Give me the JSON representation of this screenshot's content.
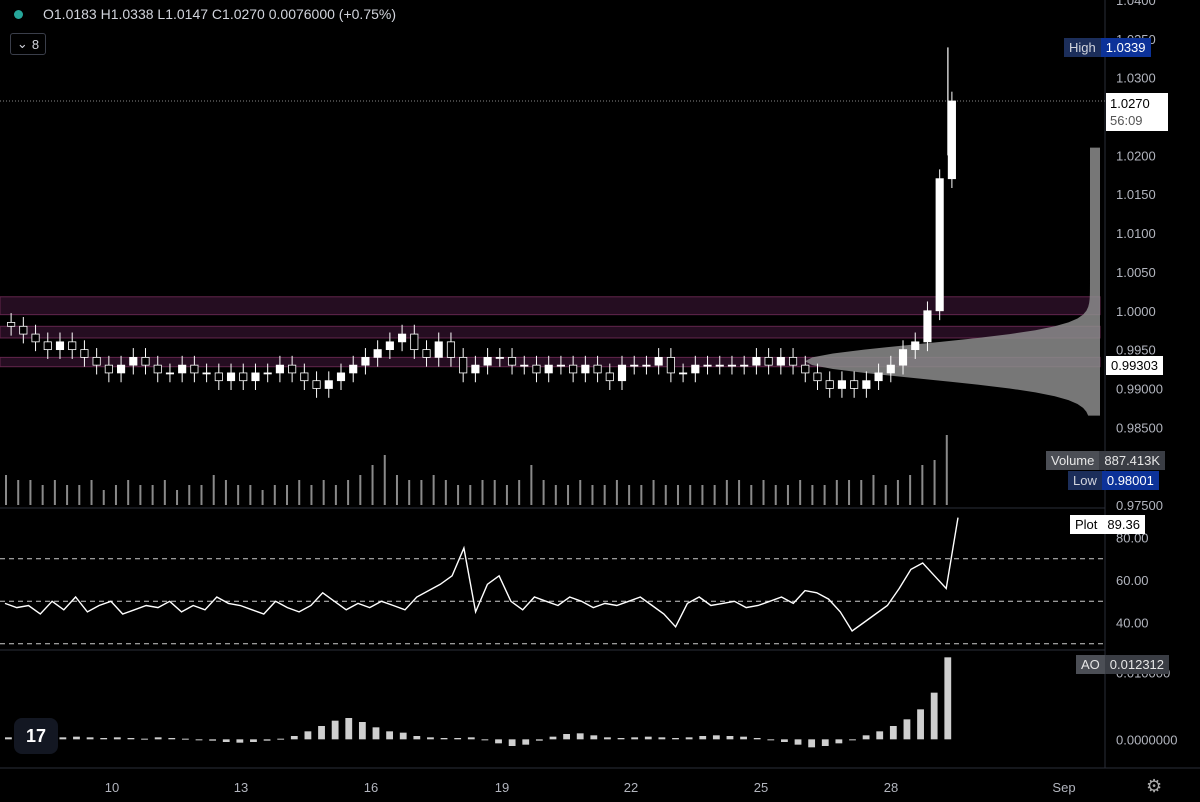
{
  "header": {
    "ohlc": "O1.0183 H1.0338 L1.0147 C1.0270 0.0076000 (+0.75%)",
    "indicator_count": "8"
  },
  "labels": {
    "high_key": "High",
    "high_value": "1.0339",
    "price_value": "1.0270",
    "countdown": "56:09",
    "poc_value": "0.99303",
    "volume_key": "Volume",
    "volume_value": "887.413K",
    "low_key": "Low",
    "low_value": "0.98001",
    "plot_key": "Plot",
    "plot_value": "89.36",
    "ao_key": "AO",
    "ao_value": "0.012312"
  },
  "colors": {
    "background": "#000000",
    "candle": "#ffffff",
    "grid_line": "#ffffff",
    "zone": "#3a1230",
    "profile": "#9a9a9a"
  },
  "chart_data": [
    {
      "type": "candlestick",
      "y_tick_labels": [
        "1.0400",
        "1.0350",
        "1.0300",
        "1.0200",
        "1.0150",
        "1.0100",
        "1.0050",
        "1.0000",
        "0.9950",
        "0.99000",
        "0.98500",
        "0.97500"
      ],
      "x_tick_labels": [
        "10",
        "13",
        "16",
        "19",
        "22",
        "25",
        "28",
        "Sep"
      ],
      "ylim": [
        0.975,
        1.04
      ],
      "last_close": 1.027,
      "high": 1.0339,
      "low": 0.98001,
      "close_series": [
        0.998,
        0.997,
        0.996,
        0.995,
        0.996,
        0.995,
        0.994,
        0.993,
        0.992,
        0.993,
        0.994,
        0.993,
        0.992,
        0.992,
        0.993,
        0.992,
        0.992,
        0.991,
        0.992,
        0.991,
        0.992,
        0.992,
        0.993,
        0.992,
        0.991,
        0.99,
        0.991,
        0.992,
        0.993,
        0.994,
        0.995,
        0.996,
        0.997,
        0.995,
        0.994,
        0.996,
        0.994,
        0.992,
        0.993,
        0.994,
        0.994,
        0.993,
        0.993,
        0.992,
        0.993,
        0.993,
        0.992,
        0.993,
        0.992,
        0.991,
        0.993,
        0.993,
        0.993,
        0.994,
        0.992,
        0.992,
        0.993,
        0.993,
        0.993,
        0.993,
        0.993,
        0.994,
        0.993,
        0.994,
        0.993,
        0.992,
        0.991,
        0.99,
        0.991,
        0.99,
        0.991,
        0.992,
        0.993,
        0.995,
        0.996,
        1.0,
        1.017,
        1.027
      ],
      "volume_series": [
        6,
        5,
        5,
        4,
        5,
        4,
        4,
        5,
        3,
        4,
        5,
        4,
        4,
        5,
        3,
        4,
        4,
        6,
        5,
        4,
        4,
        3,
        4,
        4,
        5,
        4,
        5,
        4,
        5,
        6,
        8,
        10,
        6,
        5,
        5,
        6,
        5,
        4,
        4,
        5,
        5,
        4,
        5,
        8,
        5,
        4,
        4,
        5,
        4,
        4,
        5,
        4,
        4,
        5,
        4,
        4,
        4,
        4,
        4,
        5,
        5,
        4,
        5,
        4,
        4,
        5,
        4,
        4,
        5,
        5,
        5,
        6,
        4,
        5,
        6,
        8,
        9,
        14
      ],
      "volume_label": "887.413K"
    },
    {
      "type": "line",
      "name": "Plot",
      "y_tick_labels": [
        "80.00",
        "60.00",
        "40.00"
      ],
      "ylim": [
        28,
        92
      ],
      "levels": [
        70,
        50,
        30
      ],
      "values": [
        49,
        47,
        48,
        44,
        50,
        46,
        52,
        45,
        48,
        50,
        44,
        46,
        48,
        47,
        50,
        45,
        48,
        46,
        52,
        49,
        48,
        46,
        44,
        50,
        47,
        45,
        48,
        54,
        50,
        46,
        49,
        47,
        50,
        48,
        46,
        52,
        55,
        58,
        62,
        75,
        45,
        58,
        62,
        50,
        46,
        52,
        50,
        48,
        52,
        50,
        47,
        49,
        48,
        50,
        52,
        48,
        44,
        38,
        49,
        52,
        48,
        49,
        50,
        47,
        48,
        50,
        52,
        49,
        55,
        54,
        51,
        45,
        36,
        40,
        44,
        48,
        56,
        65,
        68,
        62,
        56,
        89.36
      ],
      "value_label": "89.36"
    },
    {
      "type": "bar",
      "name": "AO",
      "y_tick_labels": [
        "0.010000",
        "0.0000000"
      ],
      "ylim": [
        -0.004,
        0.0125
      ],
      "values": [
        0.0003,
        0.0004,
        0.0003,
        0.0002,
        0.0003,
        0.0004,
        0.0003,
        0.0002,
        0.0003,
        0.0002,
        0.0001,
        0.0003,
        0.0002,
        0.0001,
        0.0,
        -0.0002,
        -0.0004,
        -0.0005,
        -0.0004,
        -0.0002,
        0.0001,
        0.0005,
        0.0012,
        0.002,
        0.0028,
        0.0032,
        0.0026,
        0.0018,
        0.0012,
        0.001,
        0.0005,
        0.0003,
        0.0002,
        0.0002,
        0.0003,
        0.0,
        -0.0006,
        -0.001,
        -0.0008,
        -0.0002,
        0.0004,
        0.0008,
        0.0009,
        0.0006,
        0.0003,
        0.0002,
        0.0003,
        0.0004,
        0.0003,
        0.0002,
        0.0003,
        0.0005,
        0.0006,
        0.0005,
        0.0004,
        0.0002,
        0.0,
        -0.0004,
        -0.0008,
        -0.0012,
        -0.001,
        -0.0006,
        0.0,
        0.0006,
        0.0012,
        0.002,
        0.003,
        0.0045,
        0.007,
        0.0123
      ],
      "value_label": "0.012312"
    }
  ]
}
